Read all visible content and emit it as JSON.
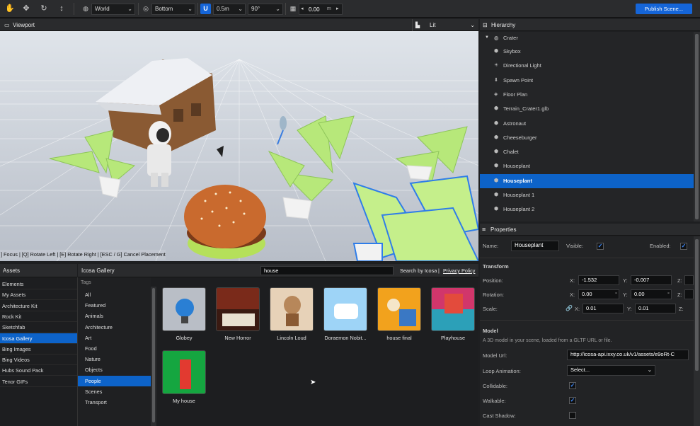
{
  "toolbar": {
    "space": "World",
    "pivot": "Bottom",
    "snap_distance": "0.5m",
    "snap_angle": "90°",
    "grid_value": "0.00",
    "grid_unit": "m",
    "publish_label": "Publish Scene..."
  },
  "viewport": {
    "title": "Viewport",
    "render_mode": "Lit",
    "hint": "] Focus | [Q] Rotate Left | [E] Rotate Right | [ESC / G] Cancel Placement"
  },
  "hierarchy": {
    "title": "Hierarchy",
    "root": "Crater",
    "items": [
      {
        "label": "Skybox",
        "icon": "sky-icon"
      },
      {
        "label": "Directional Light",
        "icon": "light-icon"
      },
      {
        "label": "Spawn Point",
        "icon": "spawn-icon"
      },
      {
        "label": "Floor Plan",
        "icon": "floor-icon"
      },
      {
        "label": "Terrain_Crater1.glb",
        "icon": "model-icon"
      },
      {
        "label": "Astronaut",
        "icon": "model-icon"
      },
      {
        "label": "Cheeseburger",
        "icon": "model-icon"
      },
      {
        "label": "Chalet",
        "icon": "model-icon"
      },
      {
        "label": "Houseplant",
        "icon": "model-icon"
      },
      {
        "label": "Houseplant",
        "icon": "model-icon",
        "selected": true
      },
      {
        "label": "Houseplant 1",
        "icon": "model-icon"
      },
      {
        "label": "Houseplant 2",
        "icon": "model-icon"
      }
    ]
  },
  "properties": {
    "title": "Properties",
    "name_label": "Name:",
    "name_value": "Houseplant",
    "visible_label": "Visible:",
    "enabled_label": "Enabled:",
    "transform_title": "Transform",
    "position_label": "Position:",
    "rotation_label": "Rotation:",
    "scale_label": "Scale:",
    "x": "X:",
    "y": "Y:",
    "z": "Z:",
    "position_x": "-1.532",
    "position_y": "-0.007",
    "rotation_x": "0.00",
    "rotation_y": "0.00",
    "scale_x": "0.01",
    "scale_y": "0.01",
    "degree": "°",
    "model_title": "Model",
    "model_desc": "A 3D model in your scene, loaded from a GLTF URL or file.",
    "model_url_label": "Model Url:",
    "model_url_value": "http://icosa-api.ixxy.co.uk/v1/assets/e9oRt-C",
    "loop_label": "Loop Animation:",
    "loop_value": "Select...",
    "collidable_label": "Collidable:",
    "walkable_label": "Walkable:",
    "cast_shadow_label": "Cast Shadow:"
  },
  "assets": {
    "title": "Assets",
    "sources": [
      "Elements",
      "My Assets",
      "Architecture Kit",
      "Rock Kit",
      "Sketchfab",
      "Icosa Gallery",
      "Bing Images",
      "Bing Videos",
      "Hubs Sound Pack",
      "Tenor GIFs"
    ],
    "active_source": "Icosa Gallery",
    "gallery_title": "Icosa Gallery",
    "search_value": "house",
    "search_by": "Search by Icosa",
    "divider": "|",
    "privacy": "Privacy Policy",
    "tags_title": "Tags",
    "tags": [
      "All",
      "Featured",
      "Animals",
      "Architecture",
      "Art",
      "Food",
      "Nature",
      "Objects",
      "People",
      "Scenes",
      "Transport"
    ],
    "active_tag": "People",
    "results": [
      "Globey",
      "New Horror",
      "Lincoln Loud",
      "Doraemon Nobit...",
      "house final",
      "Playhouse",
      "My house"
    ]
  },
  "colors": {
    "accent": "#0d63c9",
    "panel": "#1e1f21",
    "header": "#2a2b2d"
  }
}
